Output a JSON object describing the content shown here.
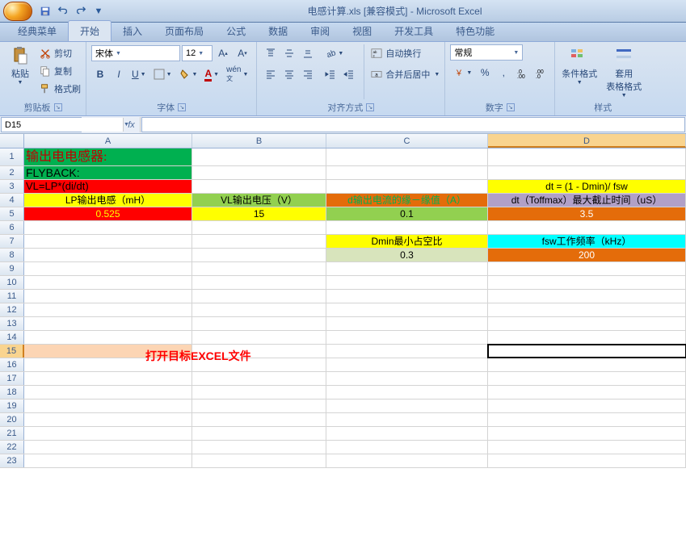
{
  "title": "电感计算.xls  [兼容模式] - Microsoft Excel",
  "tabs": {
    "classic": "经典菜单",
    "home": "开始",
    "insert": "插入",
    "layout": "页面布局",
    "formulas": "公式",
    "data": "数据",
    "review": "审阅",
    "view": "视图",
    "developer": "开发工具",
    "special": "特色功能"
  },
  "ribbon": {
    "clipboard": {
      "label": "剪贴板",
      "paste": "粘贴",
      "cut": "剪切",
      "copy": "复制",
      "painter": "格式刷"
    },
    "font": {
      "label": "字体",
      "family": "宋体",
      "size": "12"
    },
    "align": {
      "label": "对齐方式",
      "wrap": "自动换行",
      "merge": "合并后居中"
    },
    "number": {
      "label": "数字",
      "format": "常规"
    },
    "styles": {
      "label": "样式",
      "cond": "条件格式",
      "table": "套用\n表格格式"
    }
  },
  "namebox": "D15",
  "cols": [
    "A",
    "B",
    "C",
    "D"
  ],
  "cells": {
    "A1": "输出电电感器:",
    "A2": "FLYBACK:",
    "A3": "VL=LP*(di/dt)",
    "D3": "dt = (1 - Dmin)/ fsw",
    "A4": "LP输出电感（mH）",
    "B4": "VL输出电压（V）",
    "C4": "d输出电流的缘－缘值（A）",
    "D4": "dt（Toffmax）最大截止时间（uS）",
    "A5": "0.525",
    "B5": "15",
    "C5": "0.1",
    "D5": "3.5",
    "C7": "Dmin最小占空比",
    "D7": "fsw工作频率（kHz）",
    "C8": "0.3",
    "D8": "200"
  },
  "notice": "打开目标EXCEL文件"
}
